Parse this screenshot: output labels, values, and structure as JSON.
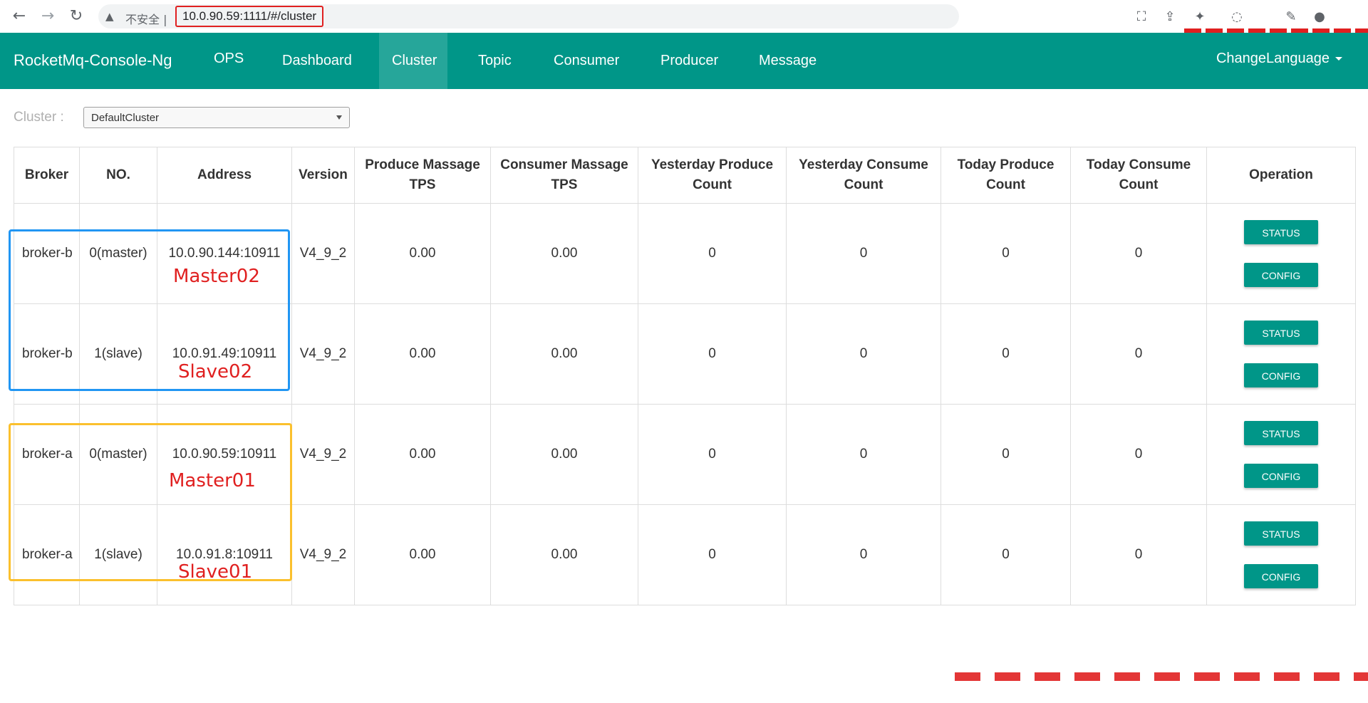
{
  "browser": {
    "insecure_label": "不安全",
    "separator": "|",
    "url": "10.0.90.59:1111/#/cluster"
  },
  "navbar": {
    "brand": "RocketMq-Console-Ng",
    "items": [
      {
        "label": "OPS"
      },
      {
        "label": "Dashboard"
      },
      {
        "label": "Cluster",
        "active": true
      },
      {
        "label": "Topic"
      },
      {
        "label": "Consumer"
      },
      {
        "label": "Producer"
      },
      {
        "label": "Message"
      }
    ],
    "change_language": "ChangeLanguage"
  },
  "cluster": {
    "label": "Cluster :",
    "selected": "DefaultCluster"
  },
  "table": {
    "headers": [
      "Broker",
      "NO.",
      "Address",
      "Version",
      "Produce Massage TPS",
      "Consumer Massage TPS",
      "Yesterday Produce Count",
      "Yesterday Consume Count",
      "Today Produce Count",
      "Today Consume Count",
      "Operation"
    ],
    "rows": [
      {
        "broker": "broker-b",
        "no": "0(master)",
        "address": "10.0.90.144:10911",
        "version": "V4_9_2",
        "produce_tps": "0.00",
        "consumer_tps": "0.00",
        "y_produce": "0",
        "y_consume": "0",
        "t_produce": "0",
        "t_consume": "0"
      },
      {
        "broker": "broker-b",
        "no": "1(slave)",
        "address": "10.0.91.49:10911",
        "version": "V4_9_2",
        "produce_tps": "0.00",
        "consumer_tps": "0.00",
        "y_produce": "0",
        "y_consume": "0",
        "t_produce": "0",
        "t_consume": "0"
      },
      {
        "broker": "broker-a",
        "no": "0(master)",
        "address": "10.0.90.59:10911",
        "version": "V4_9_2",
        "produce_tps": "0.00",
        "consumer_tps": "0.00",
        "y_produce": "0",
        "y_consume": "0",
        "t_produce": "0",
        "t_consume": "0"
      },
      {
        "broker": "broker-a",
        "no": "1(slave)",
        "address": "10.0.91.8:10911",
        "version": "V4_9_2",
        "produce_tps": "0.00",
        "consumer_tps": "0.00",
        "y_produce": "0",
        "y_consume": "0",
        "t_produce": "0",
        "t_consume": "0"
      }
    ],
    "status_label": "STATUS",
    "config_label": "CONFIG"
  },
  "annotations": {
    "master02": "Master02",
    "slave02": "Slave02",
    "master01": "Master01",
    "slave01": "Slave01"
  },
  "colors": {
    "primary": "#009688",
    "active_nav": "#26a69a",
    "highlight_blue": "#2196f3",
    "highlight_yellow": "#fbc02d",
    "annotation_red": "#e02020"
  },
  "icons": [
    "back-arrow-icon",
    "forward-arrow-icon",
    "reload-icon",
    "warning-icon",
    "translate-icon",
    "share-icon",
    "extension-icon",
    "profile-icon"
  ]
}
